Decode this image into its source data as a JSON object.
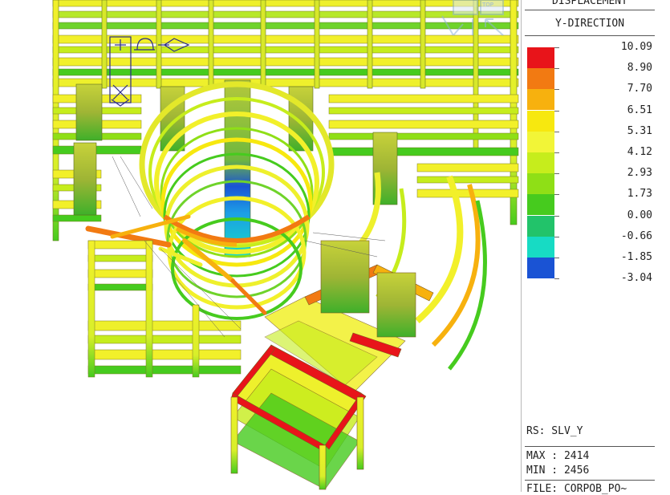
{
  "legend": {
    "title_1": "DISPLACEMENT",
    "title_2": "Y-DIRECTION",
    "entries": [
      {
        "value": "10.09",
        "color": "#e8141a"
      },
      {
        "value": "8.90",
        "color": "#f27a12"
      },
      {
        "value": "7.70",
        "color": "#f7b10e"
      },
      {
        "value": "6.51",
        "color": "#f7e80f"
      },
      {
        "value": "5.31",
        "color": "#f2f537"
      },
      {
        "value": "4.12",
        "color": "#c6ed1c"
      },
      {
        "value": "2.93",
        "color": "#8fdf16"
      },
      {
        "value": "1.73",
        "color": "#46cb1e"
      },
      {
        "value": "0.00",
        "color": "#22c36a"
      },
      {
        "value": "-0.66",
        "color": "#17dbc4"
      },
      {
        "value": "-1.85",
        "color": "#1c9ee6"
      },
      {
        "value": "-3.04",
        "color": ""
      }
    ],
    "bottom_color": "#1a53d4"
  },
  "info": {
    "rs": "RS: SLV_Y",
    "max": "MAX : 2414",
    "min": "MIN : 2456",
    "file": "FILE: CORPOB_PO~"
  },
  "view_cube": {
    "label": "TOP"
  },
  "colors": {
    "red": "#e8141a",
    "orange": "#f27a12",
    "amber": "#f7b10e",
    "yellow": "#f2f02a",
    "yellowgreen": "#c6ed1c",
    "green": "#46cb1e",
    "darkgreen": "#2fae2a",
    "cyan": "#17dbc4",
    "blue": "#1a53d4",
    "olive": "#8a9a2a"
  }
}
